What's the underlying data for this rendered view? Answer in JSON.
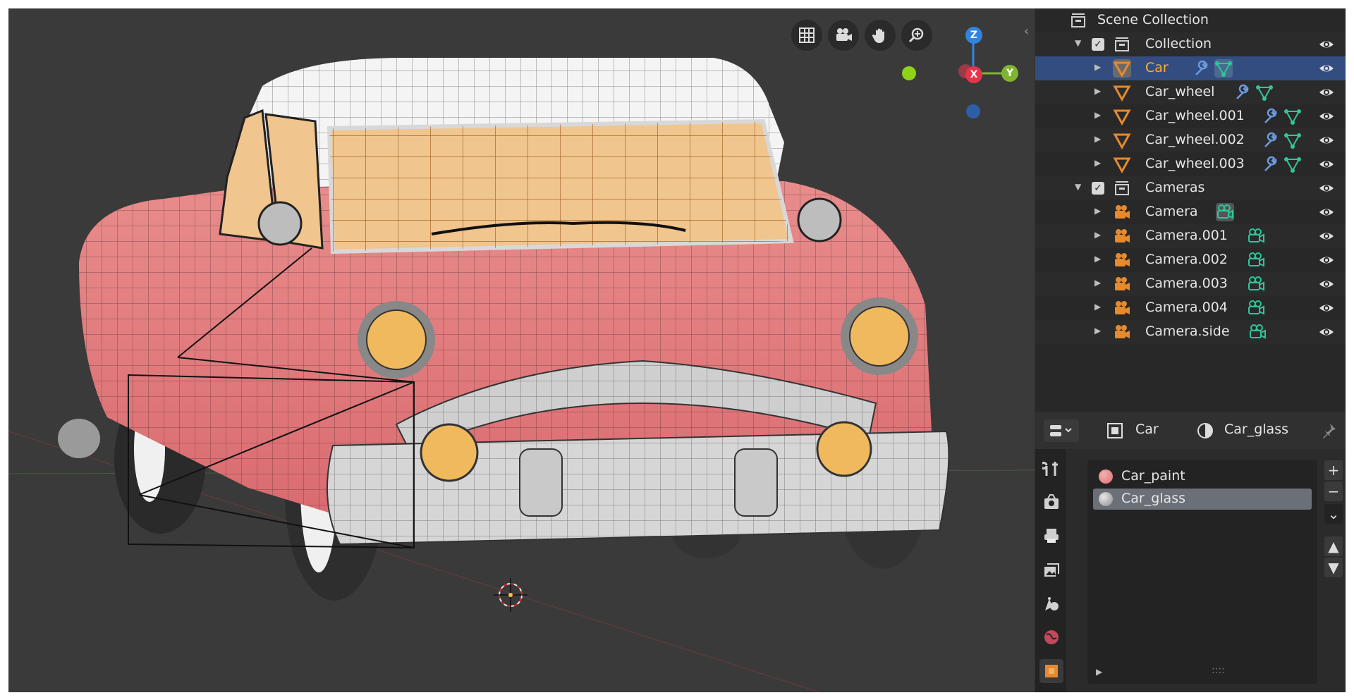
{
  "viewport": {
    "nav_icons": [
      "grid-icon",
      "camera-icon",
      "hand-pan-icon",
      "zoom-icon"
    ],
    "gizmo": {
      "z_label": "Z",
      "x_label": "X",
      "y_label": "Y",
      "colors": {
        "x": "#e8334a",
        "y": "#7fb52d",
        "z": "#2f84e0"
      }
    }
  },
  "outliner": {
    "root_label": "Scene Collection",
    "rows": [
      {
        "label": "Collection",
        "type": "collection"
      },
      {
        "label": "Car",
        "type": "mesh",
        "selected": true
      },
      {
        "label": "Car_wheel",
        "type": "mesh"
      },
      {
        "label": "Car_wheel.001",
        "type": "mesh"
      },
      {
        "label": "Car_wheel.002",
        "type": "mesh"
      },
      {
        "label": "Car_wheel.003",
        "type": "mesh"
      },
      {
        "label": "Cameras",
        "type": "collection"
      },
      {
        "label": "Camera",
        "type": "camera"
      },
      {
        "label": "Camera.001",
        "type": "camera"
      },
      {
        "label": "Camera.002",
        "type": "camera"
      },
      {
        "label": "Camera.003",
        "type": "camera"
      },
      {
        "label": "Camera.004",
        "type": "camera"
      },
      {
        "label": "Camera.side",
        "type": "camera"
      }
    ]
  },
  "properties": {
    "object_name": "Car",
    "material_name": "Car_glass",
    "slots": [
      {
        "name": "Car_paint",
        "color": "#d86f70"
      },
      {
        "name": "Car_glass",
        "color": "#a9a9a9",
        "selected": true
      }
    ],
    "slot_controls": [
      "+",
      "−",
      "⌄",
      "▲",
      "▼"
    ]
  },
  "colors": {
    "accent_selected_row": "#334d80",
    "active_label": "#ffaf29",
    "mesh_icon": "#e58a2e",
    "camera_icon": "#e58a2e",
    "data_icon_green": "#2fc69a",
    "modifier_icon_blue": "#6b9be0"
  }
}
